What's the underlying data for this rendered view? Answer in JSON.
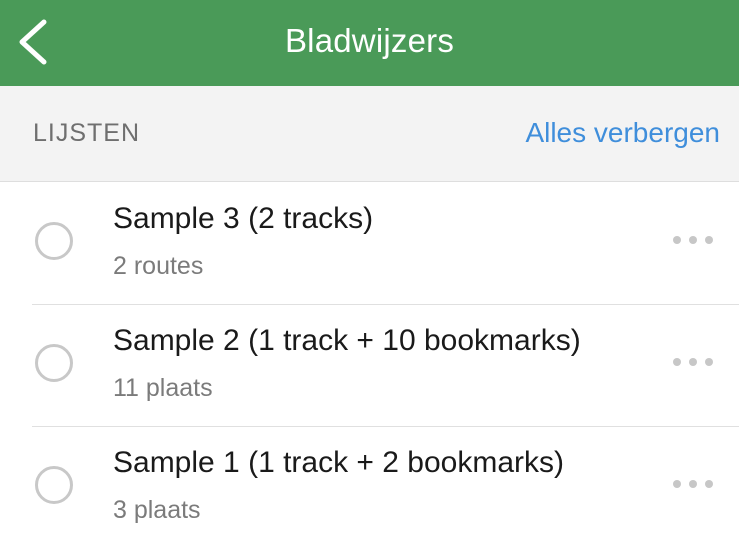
{
  "header": {
    "title": "Bladwijzers",
    "back_icon": "chevron-left-icon",
    "background_color": "#4a9a58"
  },
  "section": {
    "title": "LIJSTEN",
    "action_label": "Alles verbergen",
    "action_color": "#3f8edb"
  },
  "lists": [
    {
      "title": "Sample 3 (2 tracks)",
      "subtitle": "2 routes",
      "checked": false
    },
    {
      "title": "Sample 2 (1 track + 10 bookmarks)",
      "subtitle": "11 plaats",
      "checked": false
    },
    {
      "title": "Sample 1 (1 track + 2 bookmarks)",
      "subtitle": "3 plaats",
      "checked": false
    }
  ]
}
